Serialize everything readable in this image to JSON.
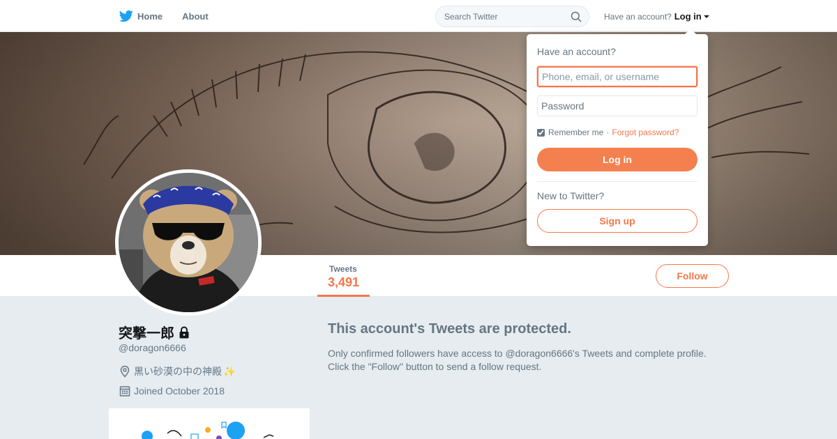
{
  "nav": {
    "logo_icon": "twitter-bird-icon",
    "home_label": "Home",
    "about_label": "About",
    "search_placeholder": "Search Twitter",
    "account_prompt": "Have an account?",
    "login_label": "Log in"
  },
  "profile": {
    "display_name": "突撃一郎",
    "screen_name": "@doragon6666",
    "location": "黒い砂漠の中の神殿",
    "location_emoji": "✨",
    "joined": "Joined October 2018",
    "tweets_label": "Tweets",
    "tweets_count": "3,491",
    "follow_label": "Follow"
  },
  "protected": {
    "title": "This account's Tweets are protected.",
    "line1": "Only confirmed followers have access to @doragon6666's Tweets and complete profile.",
    "line2": "Click the \"Follow\" button to send a follow request."
  },
  "login_dropdown": {
    "heading": "Have an account?",
    "username_placeholder": "Phone, email, or username",
    "password_placeholder": "Password",
    "remember_label": "Remember me",
    "separator": "·",
    "forgot_label": "Forgot password?",
    "login_button": "Log in",
    "new_prompt": "New to Twitter?",
    "signup_button": "Sign up"
  },
  "colors": {
    "accent": "#f4774a",
    "text_secondary": "#66757f",
    "twitter_blue": "#1da1f2"
  }
}
